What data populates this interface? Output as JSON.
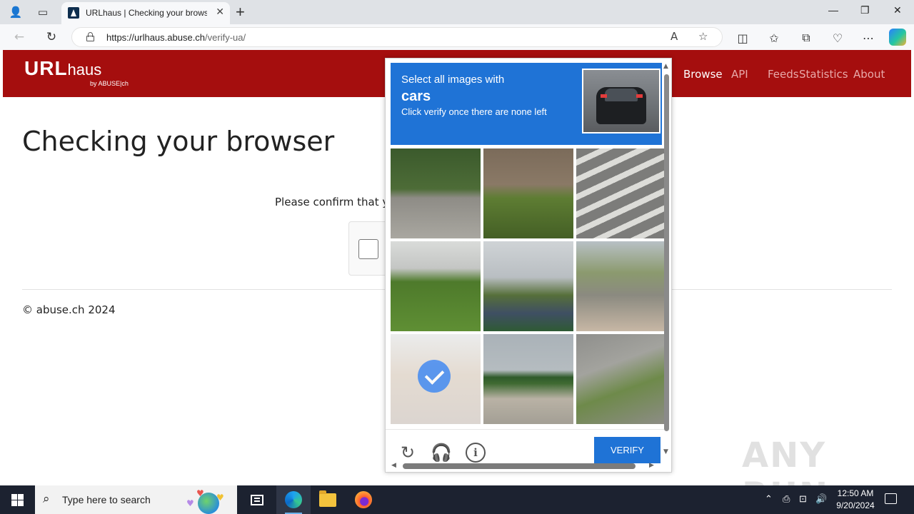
{
  "browser": {
    "tab": {
      "title": "URLhaus | Checking your browser"
    },
    "url": {
      "domain": "https://urlhaus.abuse.ch",
      "path": "/verify-ua/"
    }
  },
  "site": {
    "logo": {
      "main": "URL",
      "sub": "haus",
      "by": "by ABUSE|ch"
    },
    "nav": [
      "Browse",
      "API",
      "Feeds",
      "Statistics",
      "About"
    ],
    "heading": "Checking your browser",
    "confirm_text": "Please confirm that you",
    "footer": "© abuse.ch 2024"
  },
  "captcha": {
    "prompt_line1": "Select all images with",
    "prompt_target": "cars",
    "prompt_line3": "Click verify once there are none left",
    "tiles": [
      {
        "bg": "linear-gradient(#3b5a2c 0%, #4d6c37 45%, #8e8c86 55%, #a9a7a0 100%)",
        "selected": false
      },
      {
        "bg": "linear-gradient(#7b6b5a 0%, #8a7966 40%, #5e7d33 55%, #445f25 100%)",
        "selected": false
      },
      {
        "bg": "repeating-linear-gradient(155deg, #7c7c7a 0 14px, #dcdcd8 14px 22px)",
        "selected": false
      },
      {
        "bg": "linear-gradient(#d9dbd9 0%, #c4c6c4 30%, #4e7a2b 45%, #5f8f34 100%)",
        "selected": false
      },
      {
        "bg": "linear-gradient(#cfd3d6 0%, #b9bec2 40%, #566f3a 60%, #3f4f63 80%, #2f5a34 100%)",
        "selected": false
      },
      {
        "bg": "linear-gradient(#b8c0c5 0%, #8b9a6e 35%, #8b8a80 60%, #c7b7a5 100%)",
        "selected": false
      },
      {
        "bg": "linear-gradient(#d6d8d8 0%, #c9b7a3 45%, #b7aaa0 100%)",
        "selected": true
      },
      {
        "bg": "linear-gradient(#aab2b8 0%, #b5bcc0 40%, #2f5a2a 48%, #3f6a32 55%, #b9b2a5 72%, #a39f95 100%)",
        "selected": false
      },
      {
        "bg": "linear-gradient(160deg, #8f8f8c 0%, #a3a39e 35%, #6e8a4a 60%, #8d8c86 100%)",
        "selected": false
      }
    ],
    "verify_label": "VERIFY"
  },
  "watermark": "ANY RUN",
  "taskbar": {
    "search_placeholder": "Type here to search",
    "time": "12:50 AM",
    "date": "9/20/2024"
  }
}
